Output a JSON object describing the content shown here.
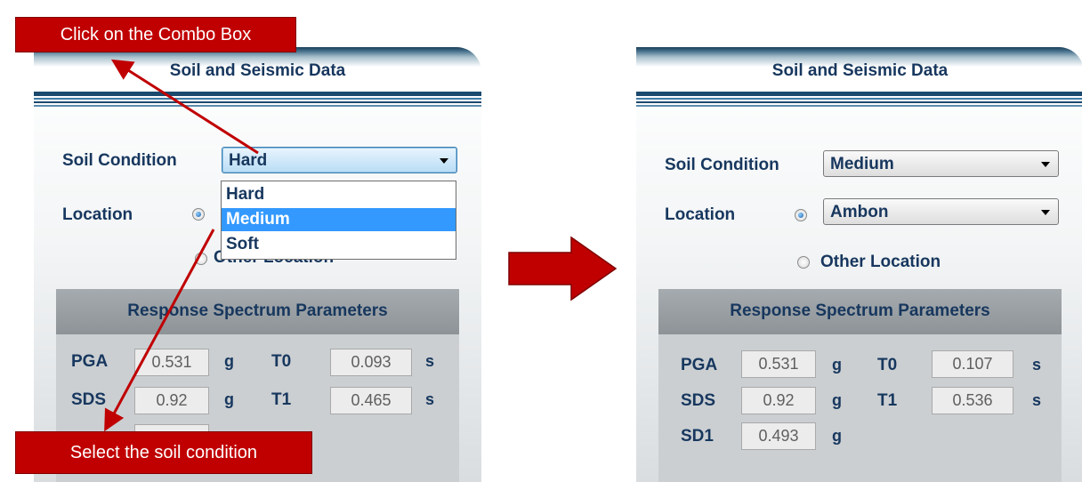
{
  "callouts": {
    "top": "Click on the Combo Box",
    "bottom": "Select the soil condition"
  },
  "left_panel": {
    "title": "Soil and Seismic Data",
    "soil_condition_label": "Soil Condition",
    "soil_condition_value": "Hard",
    "dropdown_options": [
      "Hard",
      "Medium",
      "Soft"
    ],
    "dropdown_highlighted": "Medium",
    "location_label": "Location",
    "other_location_label": "Other Location",
    "response_title": "Response Spectrum Parameters",
    "params": {
      "pga_label": "PGA",
      "pga_value": "0.531",
      "pga_unit": "g",
      "sds_label": "SDS",
      "sds_value": "0.92",
      "sds_unit": "g",
      "t0_label": "T0",
      "t0_value": "0.093",
      "t0_unit": "s",
      "t1_label": "T1",
      "t1_value": "0.465",
      "t1_unit": "s"
    }
  },
  "right_panel": {
    "title": "Soil and Seismic Data",
    "soil_condition_label": "Soil Condition",
    "soil_condition_value": "Medium",
    "location_label": "Location",
    "location_value": "Ambon",
    "other_location_label": "Other Location",
    "response_title": "Response Spectrum Parameters",
    "params": {
      "pga_label": "PGA",
      "pga_value": "0.531",
      "pga_unit": "g",
      "sds_label": "SDS",
      "sds_value": "0.92",
      "sds_unit": "g",
      "sd1_label": "SD1",
      "sd1_value": "0.493",
      "sd1_unit": "g",
      "t0_label": "T0",
      "t0_value": "0.107",
      "t0_unit": "s",
      "t1_label": "T1",
      "t1_value": "0.536",
      "t1_unit": "s"
    }
  },
  "colors": {
    "callout_red": "#c00000",
    "label_navy": "#17375e",
    "selection_blue": "#3399ff"
  }
}
